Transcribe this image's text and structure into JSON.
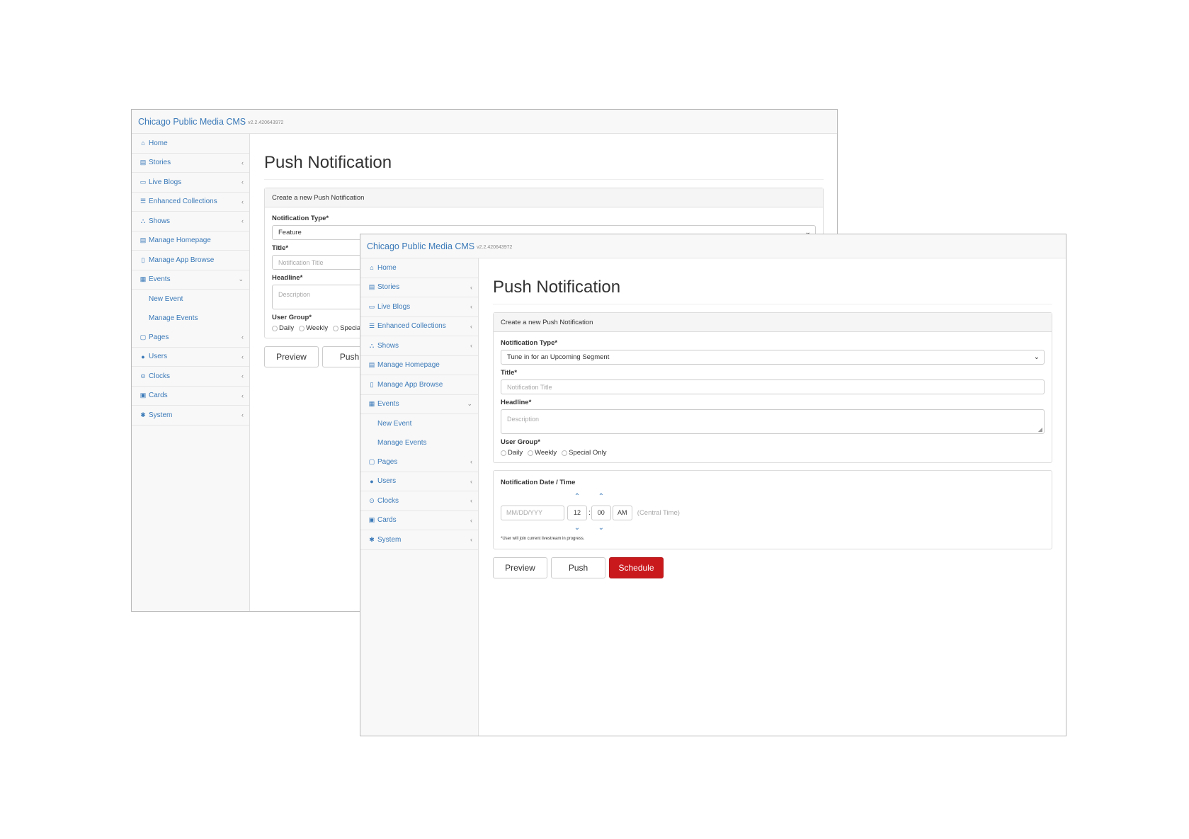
{
  "app": {
    "brand": "Chicago Public Media CMS",
    "version": "v2.2.420643972"
  },
  "sidebar": {
    "items": [
      {
        "label": "Home",
        "icon": "home-icon",
        "glyph": "⌂",
        "chevron": ""
      },
      {
        "label": "Stories",
        "icon": "newspaper-icon",
        "glyph": "▤",
        "chevron": "‹"
      },
      {
        "label": "Live Blogs",
        "icon": "laptop-icon",
        "glyph": "▭",
        "chevron": "‹"
      },
      {
        "label": "Enhanced Collections",
        "icon": "list-icon",
        "glyph": "☰",
        "chevron": "‹"
      },
      {
        "label": "Shows",
        "icon": "sitemap-icon",
        "glyph": "⛬",
        "chevron": "‹"
      },
      {
        "label": "Manage Homepage",
        "icon": "columns-icon",
        "glyph": "▤",
        "chevron": ""
      },
      {
        "label": "Manage App Browse",
        "icon": "mobile-icon",
        "glyph": "▯",
        "chevron": ""
      },
      {
        "label": "Events",
        "icon": "calendar-icon",
        "glyph": "▦",
        "chevron": "⌄"
      }
    ],
    "sub_items": [
      "New Event",
      "Manage Events"
    ],
    "items_after": [
      {
        "label": "Pages",
        "icon": "file-icon",
        "glyph": "▢",
        "chevron": "‹"
      },
      {
        "label": "Users",
        "icon": "user-icon",
        "glyph": "●",
        "chevron": "‹"
      },
      {
        "label": "Clocks",
        "icon": "clock-icon",
        "glyph": "⊙",
        "chevron": "‹"
      },
      {
        "label": "Cards",
        "icon": "id-card-icon",
        "glyph": "▣",
        "chevron": "‹"
      },
      {
        "label": "System",
        "icon": "gear-icon",
        "glyph": "✱",
        "chevron": "‹"
      }
    ]
  },
  "page": {
    "title": "Push Notification",
    "panel_heading": "Create a new Push Notification",
    "notification_type_label": "Notification Type*",
    "title_label": "Title*",
    "title_placeholder": "Notification Title",
    "headline_label": "Headline*",
    "headline_placeholder": "Description",
    "user_group_label": "User Group*",
    "user_groups": [
      "Daily",
      "Weekly",
      "Special Only"
    ]
  },
  "back_window": {
    "notification_type_value": "Feature",
    "user_group_truncated": "Specia",
    "preview_label": "Preview",
    "push_label": "Push"
  },
  "front_window": {
    "notification_type_value": "Tune in for an Upcoming Segment",
    "datetime_label": "Notification Date / Time",
    "date_placeholder": "MM/DD/YYY",
    "hour": "12",
    "minute": "00",
    "ampm": "AM",
    "timezone": "(Central Time)",
    "note": "*User will join current livestream in progress.",
    "preview_label": "Preview",
    "push_label": "Push",
    "schedule_label": "Schedule"
  },
  "colors": {
    "link": "#3a79b8",
    "schedule_button": "#c9191d"
  }
}
